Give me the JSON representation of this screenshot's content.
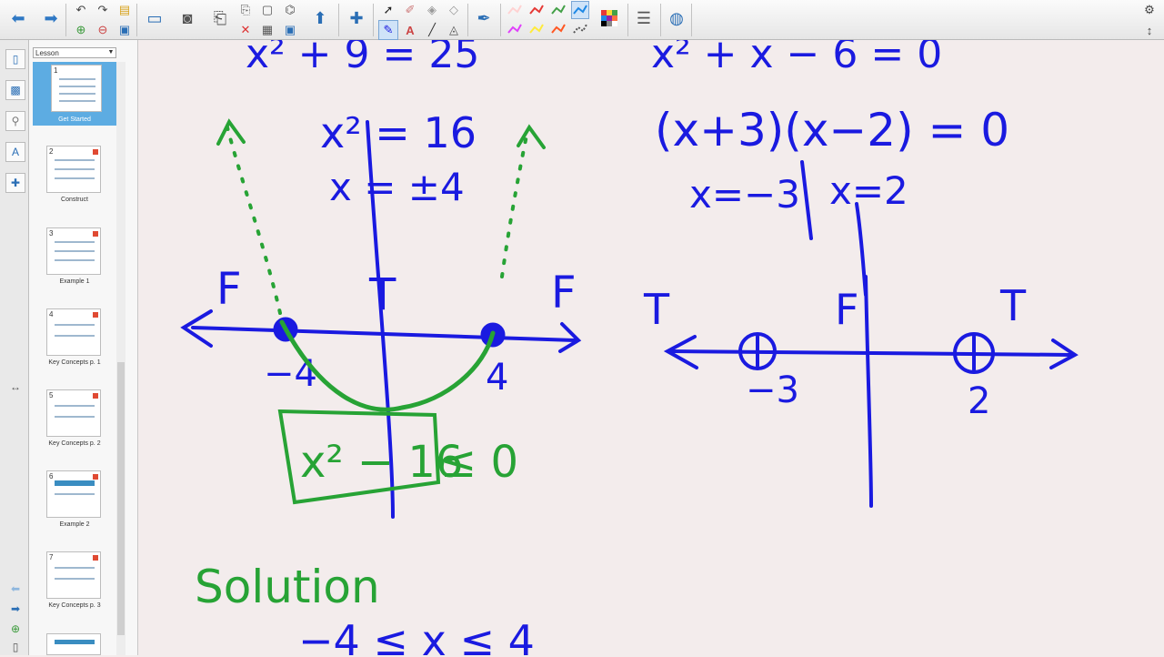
{
  "sidebar": {
    "dropdown_label": "Lesson",
    "pages": [
      {
        "number": "1",
        "caption": "Get Started",
        "selected": true
      },
      {
        "number": "2",
        "caption": "Construct",
        "selected": false
      },
      {
        "number": "3",
        "caption": "Example 1",
        "selected": false
      },
      {
        "number": "4",
        "caption": "Key Concepts p. 1",
        "selected": false
      },
      {
        "number": "5",
        "caption": "Key Concepts p. 2",
        "selected": false
      },
      {
        "number": "6",
        "caption": "Example 2",
        "selected": false
      },
      {
        "number": "7",
        "caption": "Key Concepts p. 3",
        "selected": false
      }
    ]
  },
  "toolbar": {
    "pen_colors": [
      "#ffd2d2",
      "#e53935",
      "#43a047",
      "#1e88e5",
      "#e040fb",
      "#ffeb3b",
      "#ff5722",
      "#555555"
    ]
  },
  "whiteboard": {
    "left": {
      "top_equation": "x² + 9 = 25",
      "step1": "x² = 16",
      "step2": "x = ±4",
      "region_left": "F",
      "region_middle": "T",
      "region_right": "F",
      "root_left": "−4",
      "root_right": "4",
      "boxed_inequality": "x² − 16",
      "inequality_rhs": "≤ 0",
      "solution_label": "Solution",
      "solution": "−4 ≤ x ≤ 4"
    },
    "right": {
      "top_equation": "x² + x − 6 = 0",
      "factored": "(x+3)(x−2) = 0",
      "root_a": "x=−3",
      "root_b": "x=2",
      "region_left": "T",
      "region_middle": "F",
      "region_right": "T",
      "tick_left": "−3",
      "tick_right": "2"
    },
    "ink_colors": {
      "blue": "#1a1ae0",
      "green": "#27a335"
    }
  }
}
